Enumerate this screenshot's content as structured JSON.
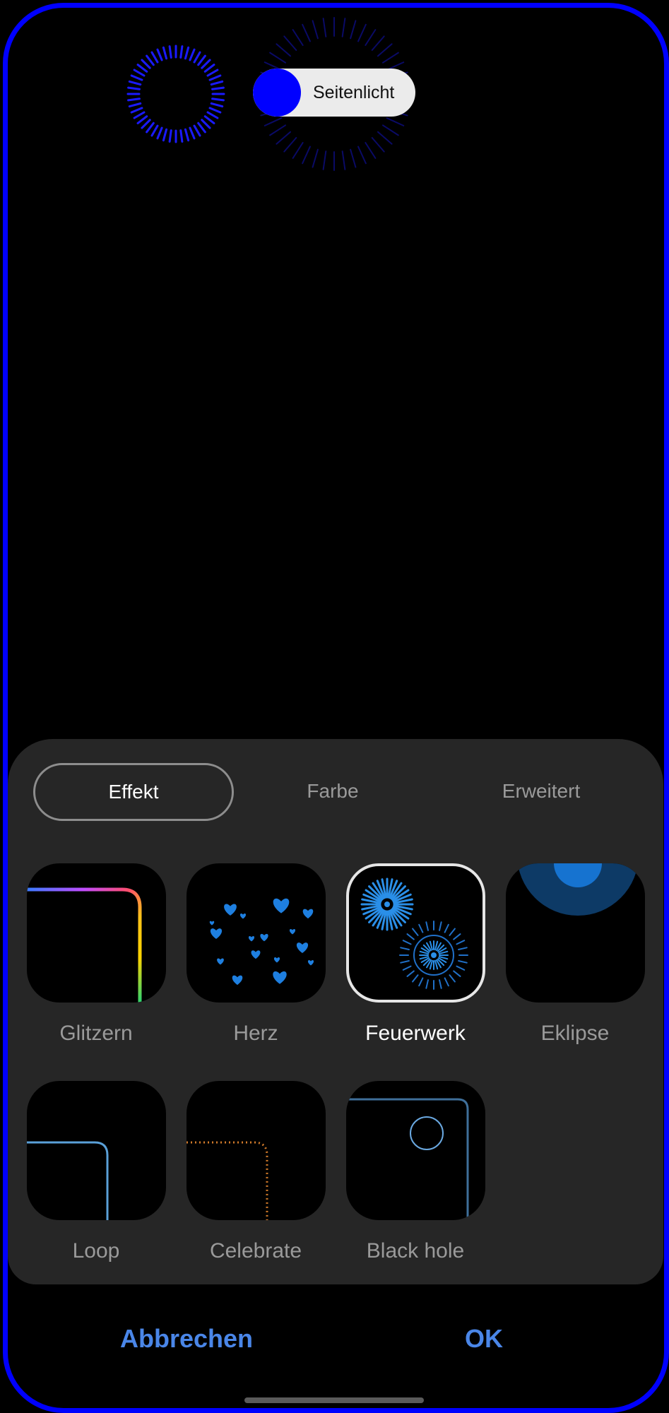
{
  "toggle": {
    "label": "Seitenlicht",
    "on": true
  },
  "tabs": [
    {
      "label": "Effekt",
      "active": true
    },
    {
      "label": "Farbe",
      "active": false
    },
    {
      "label": "Erweitert",
      "active": false
    }
  ],
  "effects": [
    {
      "label": "Glitzern",
      "selected": false,
      "icon": "rainbow-corner-icon"
    },
    {
      "label": "Herz",
      "selected": false,
      "icon": "hearts-icon"
    },
    {
      "label": "Feuerwerk",
      "selected": true,
      "icon": "fireworks-icon"
    },
    {
      "label": "Eklipse",
      "selected": false,
      "icon": "eclipse-icon"
    },
    {
      "label": "Loop",
      "selected": false,
      "icon": "loop-corner-icon"
    },
    {
      "label": "Celebrate",
      "selected": false,
      "icon": "dotted-corner-icon"
    },
    {
      "label": "Black hole",
      "selected": false,
      "icon": "black-hole-icon"
    }
  ],
  "actions": {
    "cancel": "Abbrechen",
    "ok": "OK"
  },
  "colors": {
    "edge_light": "#0000ff",
    "accent": "#4a86e8",
    "sheet": "#262626",
    "effect_blue": "#1e7fe0"
  }
}
